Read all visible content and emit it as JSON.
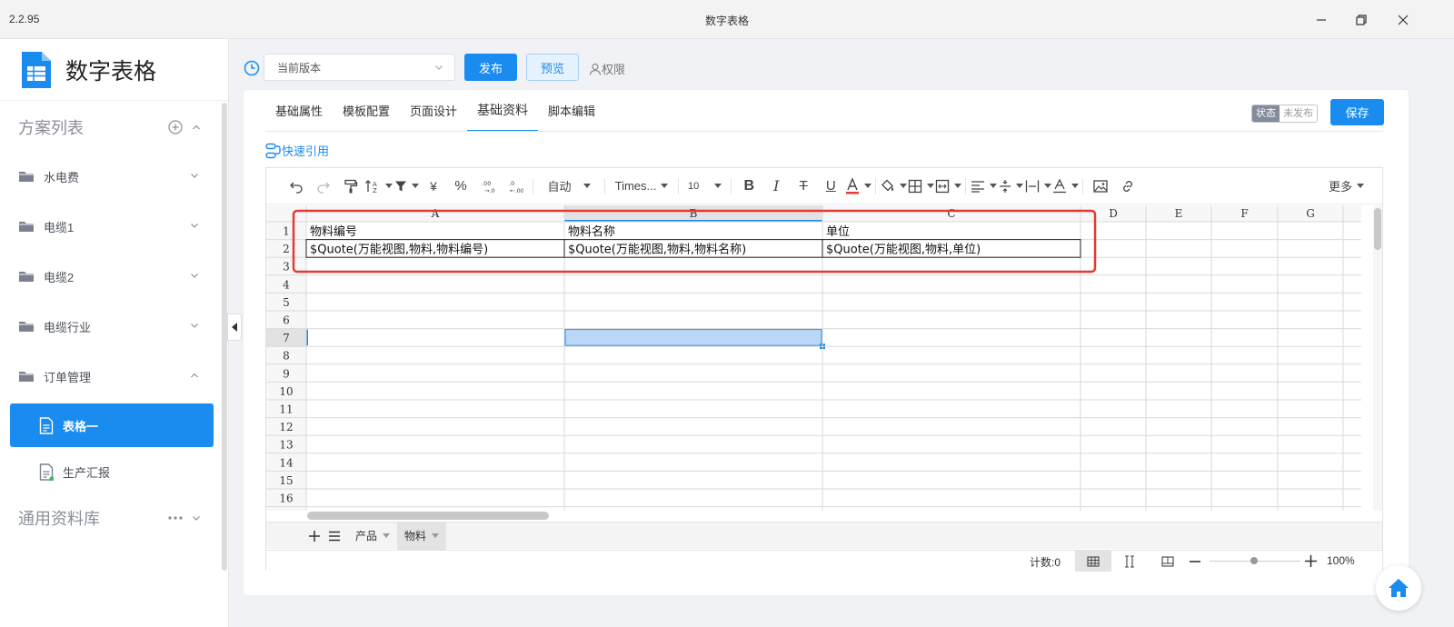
{
  "window": {
    "version": "2.2.95",
    "title": "数字表格"
  },
  "app": {
    "name": "数字表格"
  },
  "sidebar": {
    "section1": "方案列表",
    "groups": [
      {
        "label": "水电费",
        "expanded": false
      },
      {
        "label": "电缆1",
        "expanded": false
      },
      {
        "label": "电缆2",
        "expanded": false
      },
      {
        "label": "电缆行业",
        "expanded": false
      },
      {
        "label": "订单管理",
        "expanded": true
      }
    ],
    "sub_items": [
      {
        "label": "表格一",
        "active": true
      },
      {
        "label": "生产汇报",
        "active": false
      }
    ],
    "section2": "通用资料库"
  },
  "topbar": {
    "version_select": "当前版本",
    "publish": "发布",
    "preview": "预览",
    "permission": "权限"
  },
  "tabs": [
    "基础属性",
    "模板配置",
    "页面设计",
    "基础资料",
    "脚本编辑"
  ],
  "active_tab": "基础资料",
  "status": {
    "label": "状态",
    "value": "未发布"
  },
  "save": "保存",
  "quick_ref": "快速引用",
  "toolbar": {
    "format": "自动",
    "font": "Times...",
    "size": "10",
    "more": "更多"
  },
  "grid": {
    "columns": [
      "A",
      "B",
      "C",
      "D",
      "E",
      "F",
      "G"
    ],
    "rows": [
      "1",
      "2",
      "3",
      "4",
      "5",
      "6",
      "7",
      "8",
      "9",
      "10",
      "11",
      "12",
      "13",
      "14",
      "15",
      "16"
    ],
    "cells": {
      "A1": "物料编号",
      "B1": "物料名称",
      "C1": "单位",
      "A2": "$Quote(万能视图,物料,物料编号)",
      "B2": "$Quote(万能视图,物料,物料名称)",
      "C2": "$Quote(万能视图,物料,单位)"
    },
    "selected": "B7"
  },
  "sheet_tabs": [
    "产品",
    "物料"
  ],
  "active_sheet": "物料",
  "statusbar": {
    "count": "计数:0",
    "zoom": "100%"
  },
  "colors": {
    "accent": "#1a8cf0",
    "highlight": "#e53935"
  }
}
